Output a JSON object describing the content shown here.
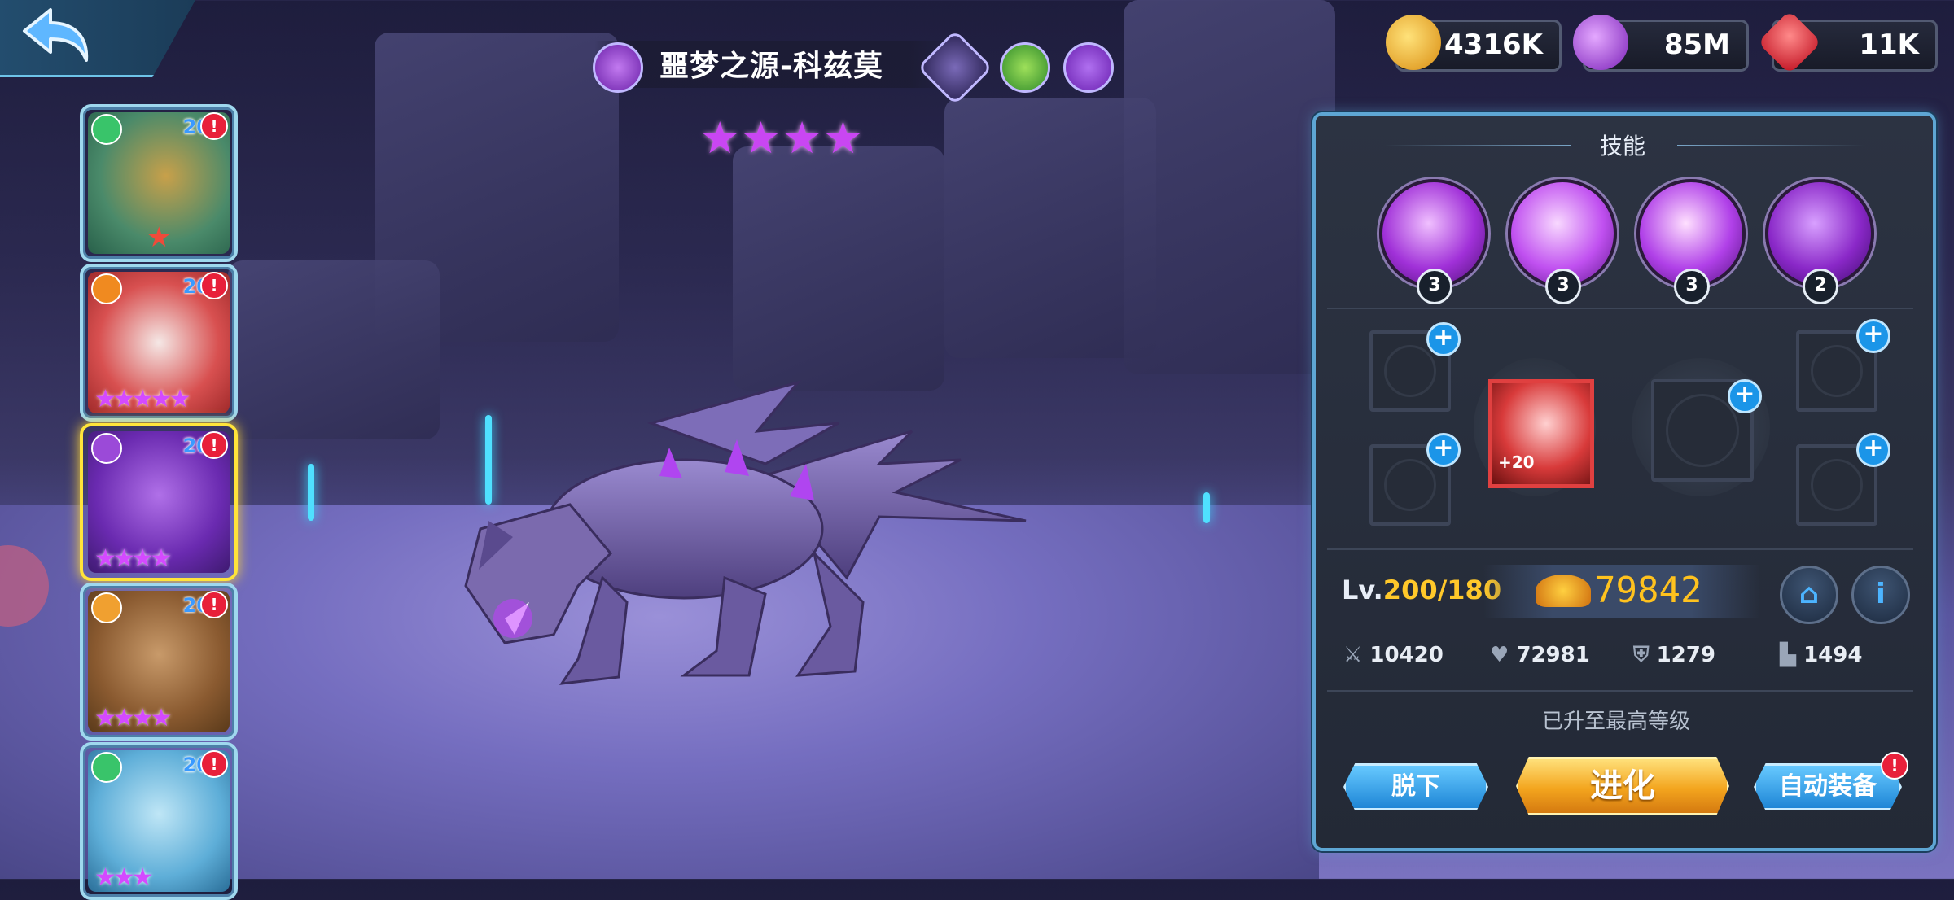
{
  "currencies": [
    {
      "name": "gold",
      "icon": "gold-coin-icon",
      "value": "4316K",
      "color": "#e7a82a"
    },
    {
      "name": "essence",
      "icon": "purple-orb-icon",
      "value": "85M",
      "color": "#a04ad8"
    },
    {
      "name": "gem",
      "icon": "red-gem-icon",
      "value": "11K",
      "color": "#e02a3a"
    }
  ],
  "hero": {
    "name": "噩梦之源-科兹莫",
    "stars": "★★★★",
    "element_color": "#9b4ad8"
  },
  "roster": [
    {
      "level": "20",
      "element": "#39c46a",
      "art": "#8ab05a",
      "stars": "",
      "selected": false
    },
    {
      "level": "20",
      "element": "#f08a20",
      "art": "#d8564e",
      "stars": "★★★★★",
      "selected": false
    },
    {
      "level": "20",
      "element": "#9b4ad8",
      "art": "#7a3ec0",
      "stars": "★★★★",
      "selected": true
    },
    {
      "level": "20",
      "element": "#f0a030",
      "art": "#9a6a3a",
      "stars": "★★★★",
      "selected": false
    },
    {
      "level": "20",
      "element": "#39c46a",
      "art": "#6ab8d8",
      "stars": "★★★",
      "selected": false
    }
  ],
  "panel": {
    "skills_title": "技能",
    "skills": [
      {
        "icon": "shield-skill-icon",
        "level": "3"
      },
      {
        "icon": "heal-skill-icon",
        "level": "3"
      },
      {
        "icon": "slash-skill-icon",
        "level": "3"
      },
      {
        "icon": "vortex-skill-icon",
        "level": "2"
      }
    ],
    "equipped_item": {
      "icon": "torch-item-icon",
      "enhance": "+20"
    },
    "level": {
      "prefix": "Lv.",
      "value": "200/180"
    },
    "power": "79842",
    "stats": [
      {
        "icon": "sword-icon",
        "value": "10420"
      },
      {
        "icon": "heart-icon",
        "value": "72981"
      },
      {
        "icon": "armor-icon",
        "value": "1279"
      },
      {
        "icon": "boot-icon",
        "value": "1494"
      }
    ],
    "max_level_note": "已升至最高等级",
    "buttons": {
      "unequip": "脱下",
      "evolve": "进化",
      "auto_equip": "自动装备"
    },
    "badge_mark": "!"
  }
}
